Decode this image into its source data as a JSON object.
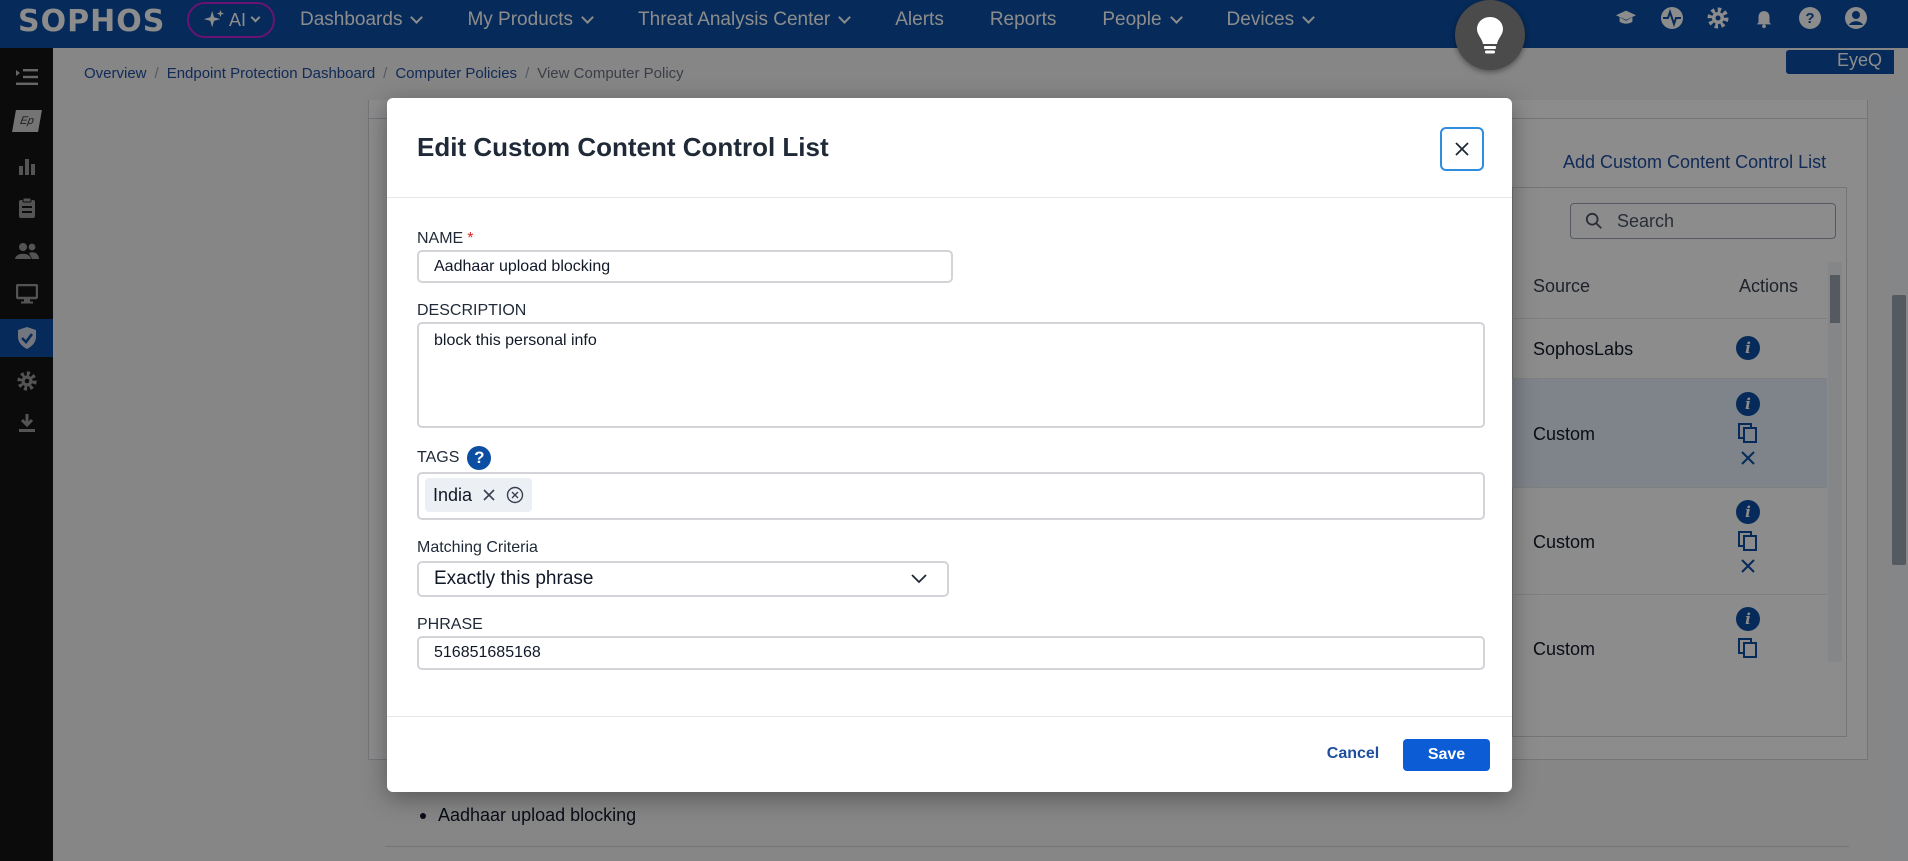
{
  "app": {
    "logo": "SOPHOS",
    "ai_label": "AI",
    "eyeq_label": "EyeQ"
  },
  "nav": {
    "items": [
      {
        "label": "Dashboards",
        "has_dropdown": true
      },
      {
        "label": "My Products",
        "has_dropdown": true
      },
      {
        "label": "Threat Analysis Center",
        "has_dropdown": true
      },
      {
        "label": "Alerts",
        "has_dropdown": false
      },
      {
        "label": "Reports",
        "has_dropdown": false
      },
      {
        "label": "People",
        "has_dropdown": true
      },
      {
        "label": "Devices",
        "has_dropdown": true
      }
    ],
    "right_icons": [
      "graduation-cap-icon",
      "pulse-icon",
      "gear-icon",
      "bell-icon",
      "help-icon",
      "user-account-icon"
    ]
  },
  "sidebar": {
    "items": [
      "collapse-menu-icon",
      "endpoint-protection-icon",
      "dashboard-chart-icon",
      "clipboard-icon",
      "users-icon",
      "devices-icon",
      "shield-icon",
      "settings-icon",
      "download-icon"
    ],
    "active": "shield-icon",
    "ep_label": "Ep"
  },
  "breadcrumb": {
    "items": [
      "Overview",
      "Endpoint Protection Dashboard",
      "Computer Policies"
    ],
    "current": "View Computer Policy"
  },
  "background": {
    "add_link": "Add Custom Content Control List",
    "search_placeholder": "Search",
    "columns": {
      "source": "Source",
      "actions": "Actions"
    },
    "rows": [
      {
        "source": "SophosLabs",
        "actions": [
          "info"
        ]
      },
      {
        "source": "Custom",
        "actions": [
          "info",
          "copy",
          "delete"
        ],
        "highlighted": true
      },
      {
        "source": "Custom",
        "actions": [
          "info",
          "copy",
          "delete"
        ]
      },
      {
        "source": "Custom",
        "actions": [
          "info",
          "copy"
        ]
      }
    ],
    "bullet_item": "Aadhaar upload blocking"
  },
  "modal": {
    "title": "Edit Custom Content Control List",
    "name": {
      "label": "NAME",
      "required_mark": "*",
      "value": "Aadhaar upload blocking"
    },
    "description": {
      "label": "DESCRIPTION",
      "value": "block this personal info"
    },
    "tags": {
      "label": "TAGS",
      "help_glyph": "?",
      "values": [
        "India"
      ]
    },
    "matching": {
      "label": "Matching Criteria",
      "value": "Exactly this phrase"
    },
    "phrase": {
      "label": "PHRASE",
      "value": "516851685168"
    },
    "cancel_label": "Cancel",
    "save_label": "Save"
  },
  "colors": {
    "brand_blue": "#0b4ea2",
    "ai_border": "#c026d3",
    "save_button": "#0b5cd5",
    "required": "#dc2626",
    "highlight_row": "#e8eefb"
  }
}
